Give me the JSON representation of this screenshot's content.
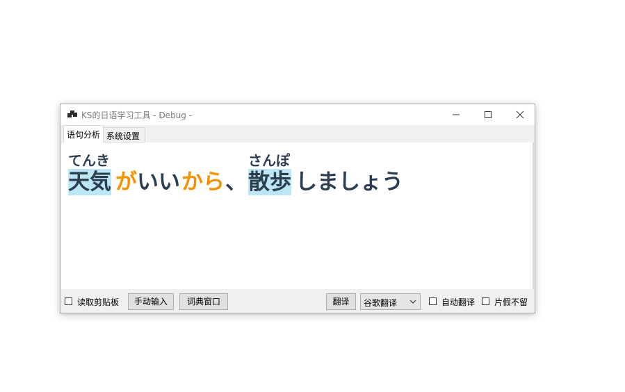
{
  "window": {
    "title": "KS的日语学习工具 - Debug -",
    "controls": {
      "minimize": "minimize",
      "maximize": "maximize",
      "close": "close"
    }
  },
  "tabs": [
    {
      "label": "语句分析",
      "active": true
    },
    {
      "label": "系统设置",
      "active": false
    }
  ],
  "sentence": {
    "tokens": [
      {
        "text": "天気",
        "reading": "てんき",
        "type": "kanji"
      },
      {
        "text": "が",
        "reading": "",
        "type": "particle"
      },
      {
        "text": "いい",
        "reading": "",
        "type": "word"
      },
      {
        "text": "から",
        "reading": "",
        "type": "particle"
      },
      {
        "text": "、",
        "reading": "",
        "type": "punct"
      },
      {
        "text": "散歩",
        "reading": "さんぽ",
        "type": "kanji"
      },
      {
        "text": "しましょう",
        "reading": "",
        "type": "word"
      }
    ],
    "colors": {
      "kanji_highlight": "#bde6f5",
      "text": "#2c3e50",
      "particle": "#f39200"
    }
  },
  "bottom": {
    "read_clipboard": {
      "label": "读取剪贴板",
      "checked": false
    },
    "manual_input_button": "手动输入",
    "dictionary_window_button": "词典窗口",
    "translate_button": "翻译",
    "translator_select": {
      "value": "谷歌翻译"
    },
    "auto_translate": {
      "label": "自动翻译",
      "checked": false
    },
    "no_stay": {
      "label": "片假不留",
      "checked": false
    }
  }
}
